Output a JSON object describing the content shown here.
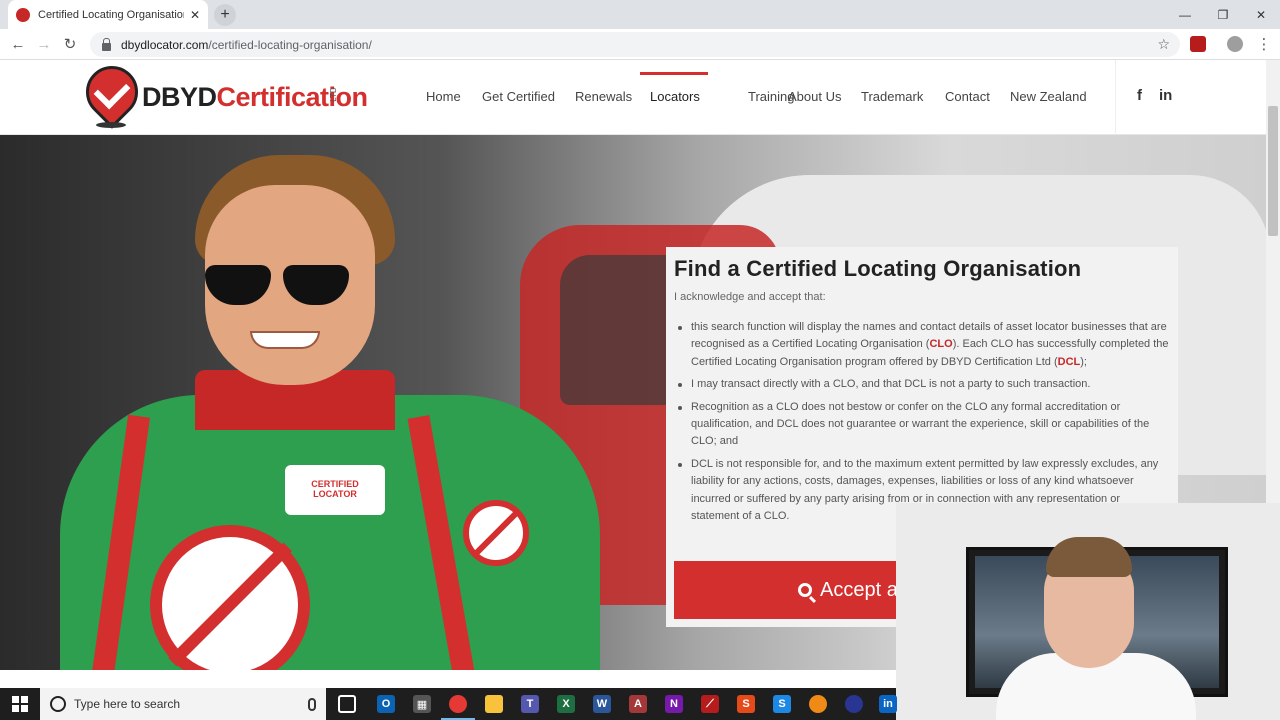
{
  "browser": {
    "tab_title": "Certified Locating Organisation -",
    "new_tab": "+",
    "tab_close": "✕",
    "url_host": "dbydlocator.com",
    "url_path": "/certified-locating-organisation/"
  },
  "site": {
    "logo_prefix": "DBYD",
    "logo_main": "Certification",
    "logo_suffix": "LTD",
    "nav": [
      "Home",
      "Get Certified",
      "Renewals",
      "Locators",
      "Training",
      "About Us",
      "Trademark",
      "Contact",
      "New Zealand"
    ],
    "active_nav": "Locators",
    "social": [
      "f",
      "in"
    ],
    "accent_color": "#d32f2f"
  },
  "hero": {
    "patch_line1": "CERTIFIED",
    "patch_line2": "LOCATOR"
  },
  "card": {
    "title": "Find a Certified Locating Organisation",
    "intro": "I acknowledge and accept that:",
    "item1_a": "this search function will display the names and contact details of asset locator businesses that are recognised as a Certified Locating Organisation (",
    "item1_clo": "CLO",
    "item1_b": ").   Each CLO has successfully completed the Certified Locating Organisation program offered by DBYD Certification Ltd (",
    "item1_dcl": "DCL",
    "item1_c": ");",
    "item2": "I may transact directly with a CLO, and that DCL is not a party to such transaction.",
    "item3": "Recognition as a CLO does not bestow or confer on the CLO any formal accreditation or qualification, and DCL does not guarantee or warrant the experience, skill or capabilities of the CLO; and",
    "item4": "DCL is not responsible for, and to the maximum extent permitted by law expressly excludes, any liability for any actions, costs, damages, expenses, liabilities or loss of any kind whatsoever incurred or suffered by any party arising from or in connection with any representation or statement of a CLO.",
    "accept_label": "Accept a"
  },
  "taskbar": {
    "search_placeholder": "Type here to search"
  }
}
